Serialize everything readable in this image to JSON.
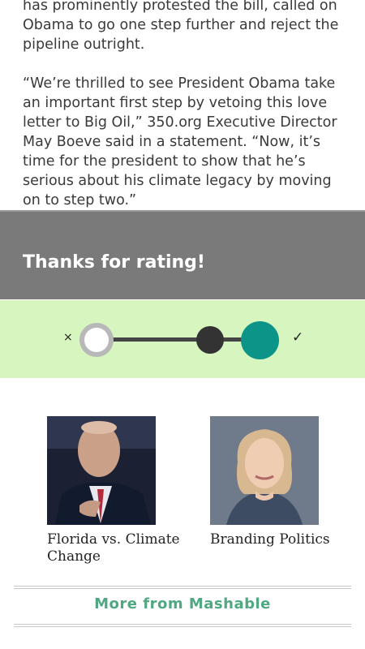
{
  "article": {
    "paragraph_1": "has prominently protested the bill, called on Obama to go one step further and reject the pipeline outright.",
    "paragraph_2": "“We’re thrilled to see President Obama take an important first step by vetoing this love letter to Big Oil,” 350.org Executive Director May Boeve said in a statement. “Now, it’s time for the president to show that he’s serious about his climate legacy by moving on to step two.”"
  },
  "rating": {
    "thanks_label": "Thanks for rating!",
    "negative_symbol": "×",
    "positive_symbol": "✓",
    "selected_level": 3,
    "level_count": 3,
    "colors": {
      "thanks_bar": "#7a7a7a",
      "rating_bar": "#d6f5bf",
      "selected_dot": "#0b9487",
      "mid_dot": "#333333",
      "empty_dot": "#b8b8b8"
    }
  },
  "related": {
    "items": [
      {
        "title": "Florida vs. Climate Change",
        "image": "man-in-suit-speaking-photo"
      },
      {
        "title": "Branding Politics",
        "image": "woman-portrait-photo"
      }
    ]
  },
  "footer": {
    "more_link": "More from Mashable",
    "link_color": "#4fa882"
  }
}
